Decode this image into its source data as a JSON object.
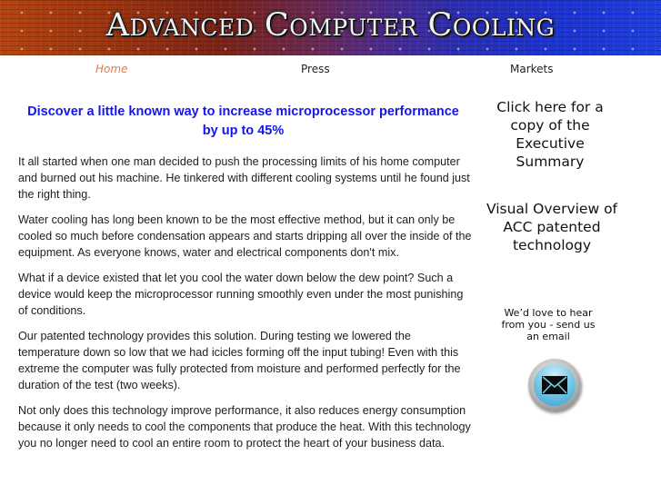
{
  "banner": {
    "title": "Advanced Computer Cooling"
  },
  "nav": {
    "items": [
      {
        "label": "Home",
        "active": true
      },
      {
        "label": "Press",
        "active": false
      },
      {
        "label": "Markets",
        "active": false
      }
    ]
  },
  "main": {
    "headline": "Discover a little known way to increase microprocessor performance by up to 45%",
    "paragraphs": [
      "It all started when one man decided to push the processing limits of his home computer and burned out his machine. He tinkered with different cooling systems until he found just the right thing.",
      "Water cooling has long been known to be the most effective method, but it can only be cooled so much before condensation appears and starts dripping all over the inside of the equipment. As everyone knows, water and electrical components don't mix.",
      "What if a device existed that let you cool the water down below the dew point? Such a device would keep the microprocessor running smoothly even under the most punishing of conditions.",
      "Our patented technology provides this solution. During testing we lowered the temperature down so low that we had icicles forming off the input tubing! Even with this extreme the computer was fully protected from moisture and performed perfectly for the duration of the test (two weeks).",
      "Not only does this technology improve performance, it also reduces energy consumption because it only needs to cool the components that produce the heat. With this technology you no longer need to cool an entire room to protect the heart of your business data."
    ]
  },
  "sidebar": {
    "executive_summary_link": "Click here for a copy of the Executive Summary",
    "visual_overview_link": "Visual Overview of ACC patented technology",
    "email_prompt": "We’d love to hear from you - send us an email",
    "email_icon": "envelope-icon"
  },
  "colors": {
    "headline": "#1414ee",
    "nav_active": "#e87a45",
    "body_text": "#1e1e1e"
  }
}
